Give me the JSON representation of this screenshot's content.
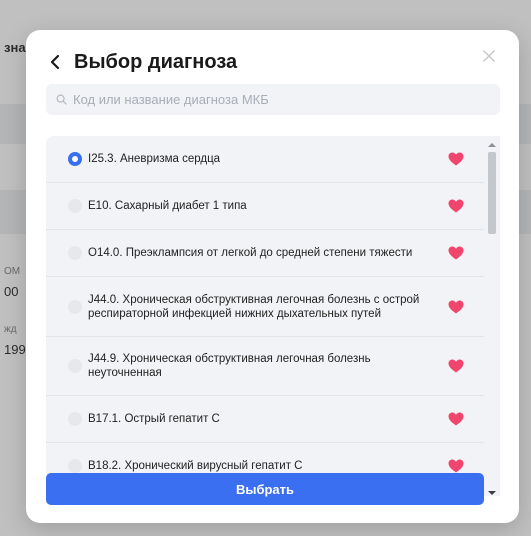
{
  "modal": {
    "title": "Выбор диагноза",
    "search_placeholder": "Код или название диагноза МКБ",
    "select_label": "Выбрать"
  },
  "background": {
    "fragments": [
      "зна",
      "ОМ",
      "00",
      "жд",
      "199"
    ]
  },
  "colors": {
    "accent": "#3a6ff2",
    "heart": "#f0466e"
  },
  "diagnoses": [
    {
      "label": "I25.3. Аневризма сердца",
      "selected": true,
      "favorite": true
    },
    {
      "label": "E10. Сахарный диабет 1 типа",
      "selected": false,
      "favorite": true
    },
    {
      "label": "O14.0. Преэклампсия от легкой до средней степени тяжести",
      "selected": false,
      "favorite": true
    },
    {
      "label": "J44.0. Хроническая обструктивная легочная болезнь с острой респираторной инфекцией нижних дыхательных путей",
      "selected": false,
      "favorite": true
    },
    {
      "label": "J44.9. Хроническая обструктивная легочная болезнь неуточненная",
      "selected": false,
      "favorite": true
    },
    {
      "label": "B17.1. Острый гепатит C",
      "selected": false,
      "favorite": true
    },
    {
      "label": "B18.2. Хронический вирусный гепатит C",
      "selected": false,
      "favorite": true
    }
  ]
}
